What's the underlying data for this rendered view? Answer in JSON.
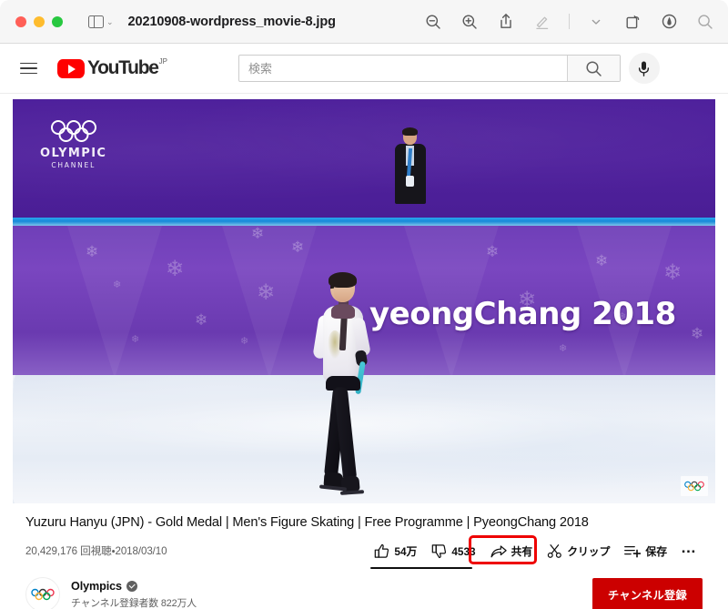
{
  "window": {
    "document_title": "20210908-wordpress_movie-8.jpg",
    "traffic_lights": [
      "close-button",
      "minimize-button",
      "zoom-button"
    ],
    "toolbar": {
      "sidebar_toggle": "sidebar-toggle",
      "zoom_out": "zoom-out",
      "zoom_in": "zoom-in",
      "share": "share",
      "markup": "markup",
      "markup_dropdown": "markup-options",
      "rotate": "rotate",
      "annotate": "annotate",
      "search": "search"
    }
  },
  "youtube_header": {
    "menu_label": "guide-menu",
    "logo_text": "YouTube",
    "logo_country": "JP",
    "search": {
      "value": "",
      "placeholder": "検索",
      "submit_label": "search-submit",
      "voice_label": "voice-search"
    }
  },
  "player": {
    "overlay_watermark": {
      "name": "OLYMPIC",
      "sub": "CHANNEL"
    },
    "banner_text": "yeongChang 2018",
    "corner_badge": "olympic-rings"
  },
  "video": {
    "title": "Yuzuru Hanyu (JPN) - Gold Medal | Men's Figure Skating | Free Programme | PyeongChang 2018",
    "views": "20,429,176 回視聴",
    "separator": "•",
    "published": "2018/03/10",
    "views_line": "20,429,176 回視聴・2018/03/10",
    "actions": [
      {
        "id": "like",
        "label": "54万",
        "icon": "thumbs-up-icon",
        "highlighted": false
      },
      {
        "id": "dislike",
        "label": "4533",
        "icon": "thumbs-down-icon",
        "highlighted": false
      },
      {
        "id": "share",
        "label": "共有",
        "icon": "share-arrow-icon",
        "highlighted": true
      },
      {
        "id": "clip",
        "label": "クリップ",
        "icon": "scissors-icon",
        "highlighted": false
      },
      {
        "id": "save",
        "label": "保存",
        "icon": "save-list-icon",
        "highlighted": false
      }
    ],
    "more_label": "…"
  },
  "channel": {
    "avatar_label": "olympics-avatar",
    "name": "Olympics",
    "verified": true,
    "subscribers": "チャンネル登録者数 822万人",
    "subscribe_label": "チャンネル登録"
  },
  "colors": {
    "brand_red": "#ff0000",
    "subscribe_red": "#cc0000",
    "highlight_red": "#ee0000",
    "text_primary": "#0f0f0f",
    "text_secondary": "#606060",
    "rink_purple": "#4d1f9b",
    "board_purple": "#7a46c0",
    "rail_blue": "#1789d8"
  }
}
